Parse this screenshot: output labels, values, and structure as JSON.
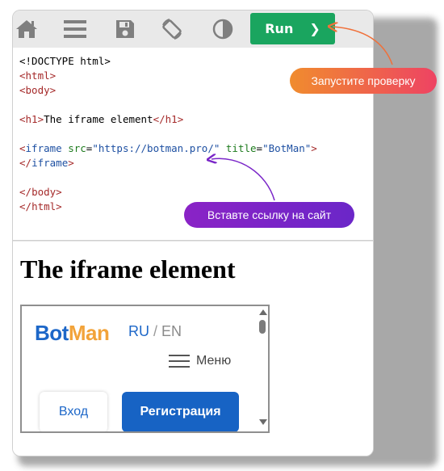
{
  "toolbar": {
    "icons": [
      "home-icon",
      "menu-icon",
      "save-icon",
      "rotate-icon",
      "contrast-icon"
    ],
    "run_label": "Run",
    "run_chevron": "❯"
  },
  "code": {
    "lines": [
      "<!DOCTYPE html>",
      "<html>",
      "<body>",
      "",
      "<h1>The iframe element</h1>",
      "",
      "<iframe src=\"https://botman.pro/\" title=\"BotMan\">",
      "</iframe>",
      "",
      "</body>",
      "</html>"
    ],
    "doctype": "<!DOCTYPE html>",
    "h1_text": "The iframe element",
    "src_value": "\"https://botman.pro/\"",
    "title_value": "\"BotMan\""
  },
  "preview": {
    "heading": "The iframe element",
    "iframe": {
      "logo_bot": "Bot",
      "logo_man": "Man",
      "lang_ru": "RU",
      "lang_slash": "/",
      "lang_en": "EN",
      "menu_label": "Меню",
      "login_label": "Вход",
      "register_label": "Регистрация"
    }
  },
  "annotations": {
    "run_hint": "Запустите проверку",
    "link_hint": "Вставте ссылку на сайт"
  },
  "colors": {
    "run_button": "#1aa55f",
    "run_hint_gradient": [
      "#f08c2e",
      "#ee4363"
    ],
    "link_hint_gradient": [
      "#8a23c6",
      "#6b26c8"
    ],
    "brand_blue": "#1d67c8",
    "brand_orange": "#f2a33a"
  }
}
